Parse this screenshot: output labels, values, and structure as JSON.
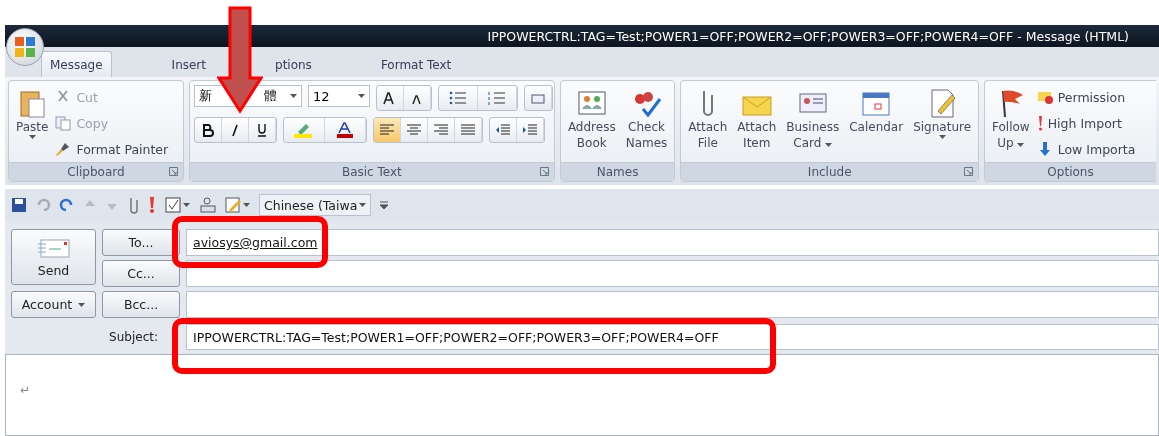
{
  "window": {
    "title": "IPPOWERCTRL:TAG=Test;POWER1=OFF;POWER2=OFF;POWER3=OFF;POWER4=OFF - Message (HTML)"
  },
  "tabs": [
    {
      "label": "Message",
      "selected": true
    },
    {
      "label": "Insert",
      "selected": false
    },
    {
      "label": "ptions",
      "selected": false
    },
    {
      "label": "Format Text",
      "selected": false
    }
  ],
  "ribbon": {
    "clipboard": {
      "label": "Clipboard",
      "paste": "Paste",
      "small": [
        {
          "label": "Cut",
          "disabled": true
        },
        {
          "label": "Copy",
          "disabled": true
        },
        {
          "label": "Format Painter",
          "disabled": false
        }
      ]
    },
    "basic_text": {
      "label": "Basic Text",
      "font_parts": [
        "新",
        "體"
      ],
      "size": "12"
    },
    "names": {
      "label": "Names",
      "buttons": [
        {
          "lines": [
            "Address",
            "Book"
          ],
          "dropdown": false
        },
        {
          "lines": [
            "Check",
            "Names"
          ],
          "dropdown": false
        }
      ]
    },
    "include": {
      "label": "Include",
      "buttons": [
        {
          "lines": [
            "Attach",
            "File"
          ],
          "dropdown": false
        },
        {
          "lines": [
            "Attach",
            "Item"
          ],
          "dropdown": false
        },
        {
          "lines": [
            "Business",
            "Card"
          ],
          "dropdown": true
        },
        {
          "lines": [
            "Calendar"
          ],
          "dropdown": false
        },
        {
          "lines": [
            "Signature"
          ],
          "dropdown": true
        }
      ]
    },
    "options": {
      "label": "Options",
      "follow": {
        "lines": [
          "Follow",
          "Up"
        ],
        "dropdown": true
      },
      "small": [
        "Permission",
        "High Import",
        "Low Importa"
      ]
    }
  },
  "quick_access": {
    "language": "Chinese (Taiwa"
  },
  "header": {
    "send": "Send",
    "account": "Account",
    "to_button": "To...",
    "cc_button": "Cc...",
    "bcc_button": "Bcc...",
    "to_value": "aviosys@gmail.com",
    "subject_label": "Subject:",
    "subject_value": "IPPOWERCTRL:TAG=Test;POWER1=OFF;POWER2=OFF;POWER3=OFF;POWER4=OFF"
  },
  "body": {
    "mark": "↵"
  }
}
